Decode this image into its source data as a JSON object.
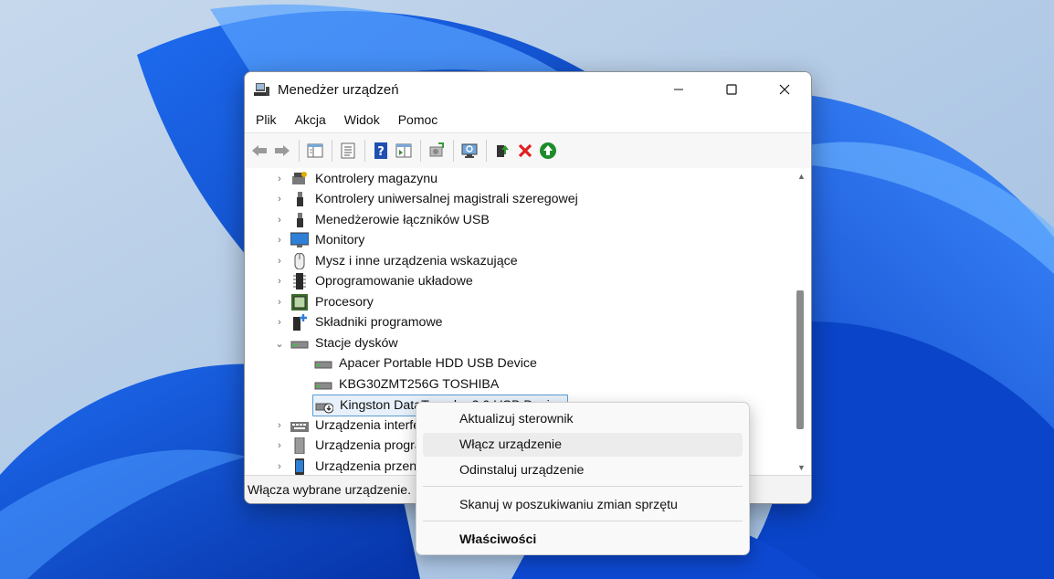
{
  "window": {
    "title": "Menedżer urządzeń"
  },
  "menubar": {
    "items": [
      "Plik",
      "Akcja",
      "Widok",
      "Pomoc"
    ]
  },
  "toolbar": {
    "buttons": [
      "back-icon",
      "forward-icon",
      "console-tree-icon",
      "properties-icon",
      "help-icon",
      "action-pane-icon",
      "update-driver-icon",
      "scan-hardware-icon",
      "enable-device-icon",
      "uninstall-icon",
      "download-icon"
    ]
  },
  "tree": {
    "items": [
      {
        "label": "Kontrolery magazynu",
        "expanded": false
      },
      {
        "label": "Kontrolery uniwersalnej magistrali szeregowej",
        "expanded": false
      },
      {
        "label": "Menedżerowie łączników USB",
        "expanded": false
      },
      {
        "label": "Monitory",
        "expanded": false
      },
      {
        "label": "Mysz i inne urządzenia wskazujące",
        "expanded": false
      },
      {
        "label": "Oprogramowanie układowe",
        "expanded": false
      },
      {
        "label": "Procesory",
        "expanded": false
      },
      {
        "label": "Składniki programowe",
        "expanded": false
      },
      {
        "label": "Stacje dysków",
        "expanded": true
      },
      {
        "label": "Apacer Portable HDD USB Device"
      },
      {
        "label": "KBG30ZMT256G TOSHIBA"
      },
      {
        "label": "Kingston DataTraveler 3.0 USB Device",
        "selected": true
      },
      {
        "label": "Urządzenia interfejsu HID",
        "expanded": false
      },
      {
        "label": "Urządzenia programowe",
        "expanded": false
      },
      {
        "label": "Urządzenia przenośne",
        "expanded": false
      }
    ]
  },
  "statusbar": {
    "text": "Włącza wybrane urządzenie."
  },
  "context_menu": {
    "items": [
      {
        "label": "Aktualizuj sterownik"
      },
      {
        "label": "Włącz urządzenie",
        "hover": true
      },
      {
        "label": "Odinstaluj urządzenie"
      },
      {
        "label": "Skanuj w poszukiwaniu zmian sprzętu"
      },
      {
        "label": "Właściwości",
        "bold": true
      }
    ]
  },
  "colors": {
    "selection_border": "#5b9bd5",
    "selection_fill": "#e8f1fb",
    "wallpaper_blue": "#0a4bd8"
  }
}
